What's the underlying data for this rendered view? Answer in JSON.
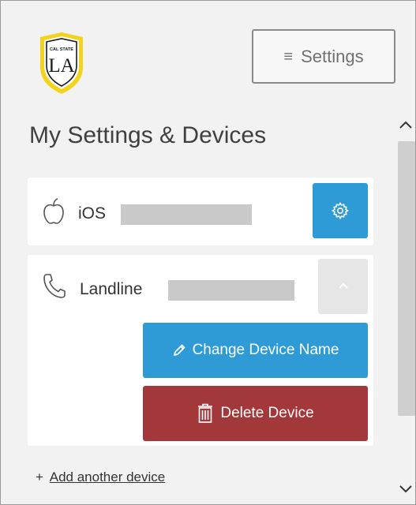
{
  "header": {
    "logo_text": "LA",
    "logo_small_text": "CAL STATE",
    "settings_button_label": "Settings",
    "menu_icon": "hamburger-icon"
  },
  "main": {
    "title": "My Settings & Devices",
    "devices": [
      {
        "type": "iOS",
        "icon": "apple-icon",
        "name_redacted": true,
        "action_icon": "gear-icon",
        "expanded": false
      },
      {
        "type": "Landline",
        "icon": "phone-icon",
        "name_redacted": true,
        "action_icon": "chevron-up-icon",
        "expanded": true,
        "actions": {
          "change_label": "Change Device Name",
          "delete_label": "Delete Device"
        }
      }
    ],
    "add_device_prefix": "+",
    "add_device_label": "Add another device"
  },
  "colors": {
    "primary_blue": "#2e9ad6",
    "danger_red": "#a3383a",
    "logo_yellow": "#f5d31b",
    "background": "#f2f2f2"
  }
}
